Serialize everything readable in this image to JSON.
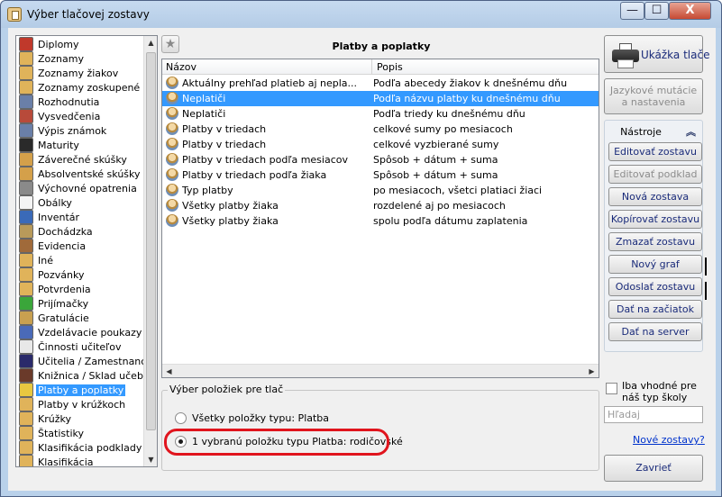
{
  "window": {
    "title": "Výber tlačovej zostavy",
    "minimize": "—",
    "maximize": "☐",
    "close": "X"
  },
  "tree": {
    "items": [
      {
        "label": "Diplomy",
        "icon": "diploma-icon",
        "color": "#c0392b"
      },
      {
        "label": "Zoznamy",
        "icon": "user-icon",
        "color": "#e0b35a"
      },
      {
        "label": "Zoznamy žiakov",
        "icon": "user-icon",
        "color": "#e0b35a"
      },
      {
        "label": "Zoznamy zoskupené",
        "icon": "user-icon",
        "color": "#e0b35a"
      },
      {
        "label": "Rozhodnutia",
        "icon": "document-icon",
        "color": "#6a7fa8"
      },
      {
        "label": "Vysvedčenia",
        "icon": "certificate-icon",
        "color": "#b84a3a"
      },
      {
        "label": "Výpis známok",
        "icon": "grades-icon",
        "color": "#6a7fa8"
      },
      {
        "label": "Maturity",
        "icon": "graduate-icon",
        "color": "#2a2a2a"
      },
      {
        "label": "Záverečné skúšky",
        "icon": "exam-icon",
        "color": "#d4a04a"
      },
      {
        "label": "Absolventské skúšky",
        "icon": "exam-icon",
        "color": "#d4a04a"
      },
      {
        "label": "Výchovné opatrenia",
        "icon": "measure-icon",
        "color": "#8a8a8a"
      },
      {
        "label": "Obálky",
        "icon": "envelope-icon",
        "color": "#f4f4f4"
      },
      {
        "label": "Inventár",
        "icon": "inventory-icon",
        "color": "#3a6ab8"
      },
      {
        "label": "Dochádzka",
        "icon": "attendance-icon",
        "color": "#b89a5a"
      },
      {
        "label": "Evidencia",
        "icon": "records-icon",
        "color": "#a06a3a"
      },
      {
        "label": "Iné",
        "icon": "user-icon",
        "color": "#e0b35a"
      },
      {
        "label": "Pozvánky",
        "icon": "user-icon",
        "color": "#e0b35a"
      },
      {
        "label": "Potvrdenia",
        "icon": "user-icon",
        "color": "#e0b35a"
      },
      {
        "label": "Prijímačky",
        "icon": "plus-icon",
        "color": "#3aa63a"
      },
      {
        "label": "Gratulácie",
        "icon": "gift-icon",
        "color": "#c8a050"
      },
      {
        "label": "Vzdelávacie poukazy",
        "icon": "voucher-icon",
        "color": "#4a6ab8"
      },
      {
        "label": "Činnosti učiteľov",
        "icon": "teacher-icon",
        "color": "#e8e8e8"
      },
      {
        "label": "Učitelia / Zamestnanci",
        "icon": "staff-icon",
        "color": "#2a2a6a"
      },
      {
        "label": "Knižnica / Sklad učebn",
        "icon": "library-icon",
        "color": "#6a3a2a"
      },
      {
        "label": "Platby a poplatky",
        "icon": "payment-icon",
        "color": "#e8c840",
        "selected": true
      },
      {
        "label": "Platby v krúžkoch",
        "icon": "user-icon",
        "color": "#e0b35a"
      },
      {
        "label": "Krúžky",
        "icon": "user-icon",
        "color": "#e0b35a"
      },
      {
        "label": "Štatistiky",
        "icon": "user-icon",
        "color": "#e0b35a"
      },
      {
        "label": "Klasifikácia podklady",
        "icon": "user-icon",
        "color": "#e0b35a"
      },
      {
        "label": "Klasifikácia",
        "icon": "user-icon",
        "color": "#e0b35a"
      }
    ]
  },
  "main": {
    "title": "Platby a poplatky",
    "columns": [
      "Názov",
      "Popis"
    ],
    "rows": [
      {
        "name": "Aktuálny prehľad platieb aj nepla...",
        "desc": "Podľa abecedy žiakov k dnešnému dňu"
      },
      {
        "name": "Neplatiči",
        "desc": "Podľa názvu platby ku dnešnému dňu",
        "selected": true
      },
      {
        "name": "Neplatiči",
        "desc": "Podľa triedy ku dnešnému dňu"
      },
      {
        "name": "Platby v triedach",
        "desc": "celkové sumy po mesiacoch"
      },
      {
        "name": "Platby v triedach",
        "desc": "celkové vyzbierané sumy"
      },
      {
        "name": "Platby v triedach podľa mesiacov",
        "desc": "Spôsob + dátum + suma"
      },
      {
        "name": "Platby v triedach podľa žiaka",
        "desc": "Spôsob + dátum + suma"
      },
      {
        "name": "Typ platby",
        "desc": "po mesiacoch, všetci platiaci žiaci"
      },
      {
        "name": "Všetky platby žiaka",
        "desc": "rozdelené aj po mesiacoch"
      },
      {
        "name": "Všetky platby žiaka",
        "desc": "spolu podľa dátumu zaplatenia"
      }
    ],
    "selection_group": {
      "title": "Výber položiek pre tlač",
      "option_all": "Všetky položky typu: Platba",
      "option_one": "1 vybranú položku typu Platba: rodičovské"
    }
  },
  "right": {
    "preview_button": "Ukážka tlače",
    "language_button": "Jazykové mutácie a nastavenia",
    "tools_title": "Nástroje",
    "tools": [
      {
        "label": "Editovať zostavu",
        "disabled": false
      },
      {
        "label": "Editovať podklad",
        "disabled": true
      },
      {
        "label": "Nová zostava",
        "disabled": false
      },
      {
        "label": "Kopírovať zostavu",
        "disabled": false
      },
      {
        "label": "Zmazať zostavu",
        "disabled": false
      },
      {
        "label": "Nový graf",
        "disabled": false
      },
      {
        "label": "Odoslať zostavu",
        "disabled": false
      },
      {
        "label": "Dať na začiatok",
        "disabled": false
      },
      {
        "label": "Dať na server",
        "disabled": false
      }
    ],
    "filter_checkbox": "Iba vhodné pre náš typ školy",
    "search_placeholder": "Hľadaj",
    "new_reports_link": "Nové zostavy?",
    "close_button": "Zavrieť"
  },
  "colors": {
    "selection": "#3399ff",
    "link": "#0033cc",
    "highlight_oval": "#e0141d"
  }
}
